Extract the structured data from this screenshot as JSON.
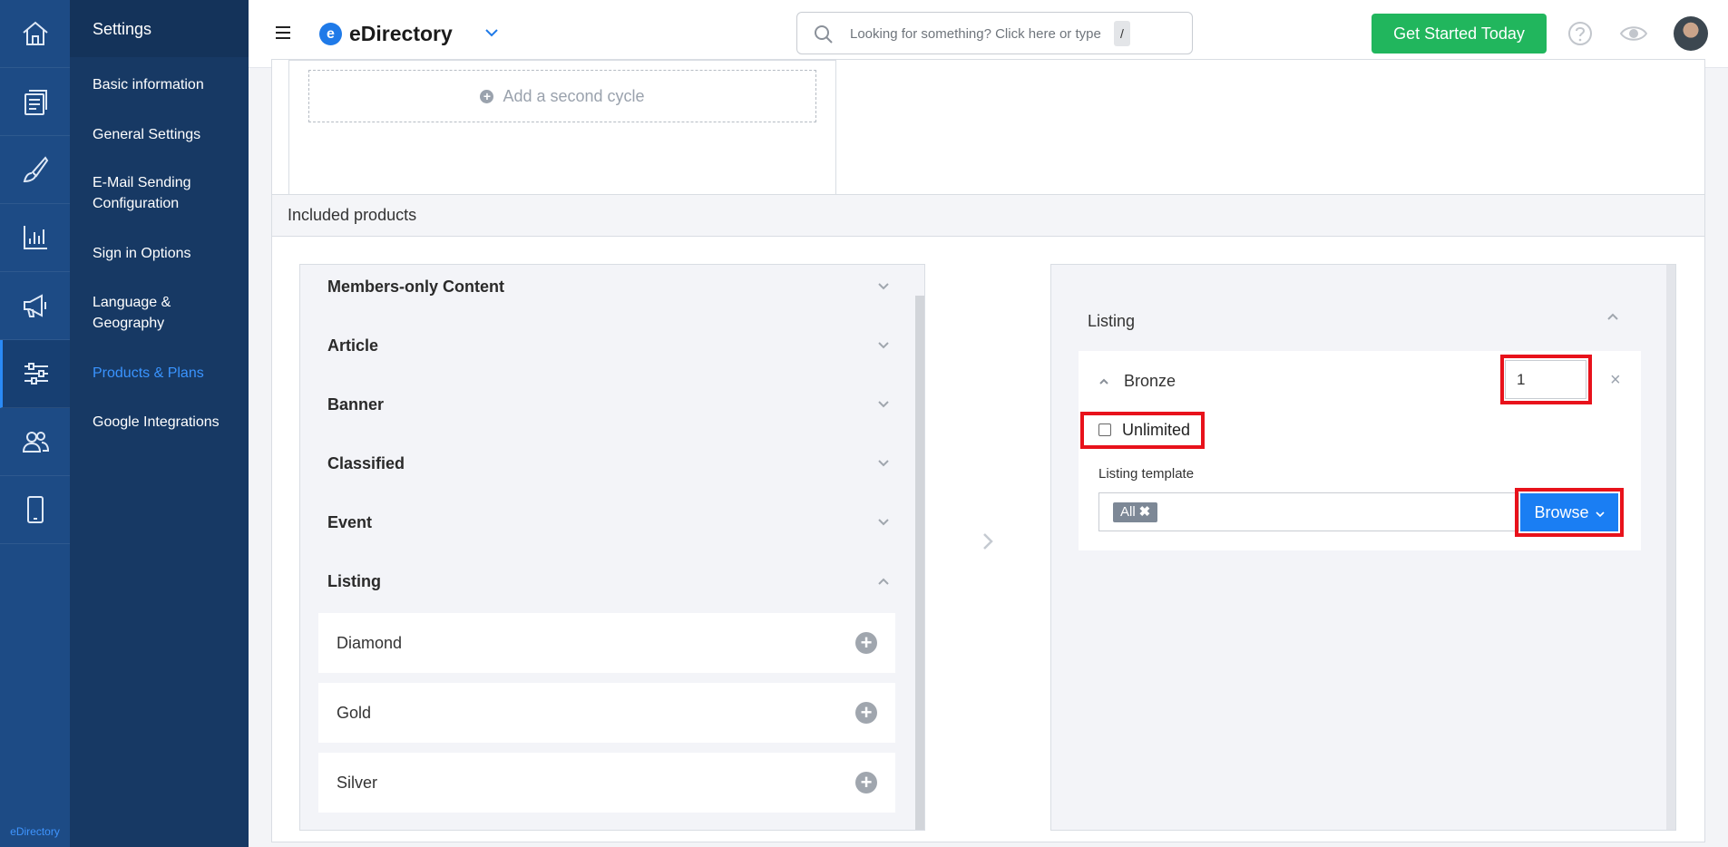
{
  "rail": {
    "items": [
      "home-icon",
      "documents-icon",
      "brush-icon",
      "bar-chart-icon",
      "megaphone-icon",
      "sliders-icon",
      "users-icon",
      "mobile-icon"
    ],
    "active": "sliders-icon",
    "brand": "eDirectory"
  },
  "menu": {
    "title": "Settings",
    "items": [
      {
        "label": "Basic information"
      },
      {
        "label": "General Settings"
      },
      {
        "label": "E-Mail Sending Configuration"
      },
      {
        "label": "Sign in Options"
      },
      {
        "label": "Language & Geography"
      },
      {
        "label": "Products & Plans"
      },
      {
        "label": "Google Integrations"
      }
    ],
    "active_color": "#3a94ff"
  },
  "topbar": {
    "logo_letter": "e",
    "logo_text": "eDirectory",
    "search_placeholder": "Looking for something? Click here or type",
    "search_shortcut": "/",
    "cta_label": "Get Started Today",
    "cta_color": "#21b65d"
  },
  "cycle": {
    "add_label": "Add a second cycle"
  },
  "products": {
    "title": "Included products",
    "categories": [
      {
        "label": "Members-only Content",
        "expanded": false
      },
      {
        "label": "Article",
        "expanded": false
      },
      {
        "label": "Banner",
        "expanded": false
      },
      {
        "label": "Classified",
        "expanded": false
      },
      {
        "label": "Event",
        "expanded": false
      },
      {
        "label": "Listing",
        "expanded": true
      }
    ],
    "listing_levels": [
      {
        "label": "Diamond"
      },
      {
        "label": "Gold"
      },
      {
        "label": "Silver"
      }
    ],
    "selected": {
      "group": "Listing",
      "item": "Bronze",
      "quantity": "1",
      "unlimited_label": "Unlimited",
      "unlimited_checked": false,
      "template_label": "Listing template",
      "template_tag": "All",
      "browse_label": "Browse"
    }
  },
  "highlight_color": "#e8121b"
}
